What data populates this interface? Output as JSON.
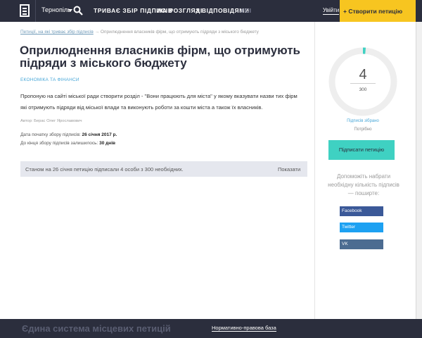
{
  "header": {
    "city": "Тернопіль",
    "nav": [
      "Триває збір підписів",
      "На розгляді",
      "З відповідями",
      "Усі"
    ],
    "login": "Увійти",
    "create_button": "+ Створити петицію"
  },
  "breadcrumb": {
    "link": "Петиції, на які триває збір підписів",
    "current": "Оприлюднення власників фірм, що отримують підряди з міського бюджету"
  },
  "petition": {
    "title": "Оприлюднення власників фірм, що отримують підряди з міського бюджету",
    "category": "Економіка та фінанси",
    "description": "Пропоную на сайті міської ради створити розділ - \"Вони працюють для міста\" у якому вказувати назви тих фірм які отримують підряди від міської влади та виконують роботи за кошти міста а також їх власників.",
    "author": "Автор: Берас Олег Ярославович",
    "start_label": "Дата початку збору підписів:",
    "start_date": "26 січня 2017 р.",
    "remaining_label": "До кінця збору підписів залишилось:",
    "remaining_value": "30 днів",
    "status_text": "Станом на 26 січня петицію підписали 4 особи з 300 необхідних.",
    "show_link": "Показати"
  },
  "signatures": {
    "collected": 4,
    "needed": 300,
    "collected_label": "Підписів зібрано",
    "needed_label": "Потрібно",
    "sign_button": "Підписати петицію",
    "help_text": "Допоможіть набрати необхідну кількість підписів — поширте:",
    "share": [
      "Facebook",
      "Twitter",
      "VK"
    ]
  },
  "colors": {
    "header_bg": "#2b2e3d",
    "accent_yellow": "#f7c520",
    "accent_teal": "#3fd1c2",
    "link_blue": "#4aa8d8",
    "facebook": "#3b5998",
    "twitter": "#1da1f2",
    "vk": "#4c6c91"
  },
  "footer": {
    "title": "Єдина система місцевих петицій",
    "link": "Нормативно-правова база"
  }
}
